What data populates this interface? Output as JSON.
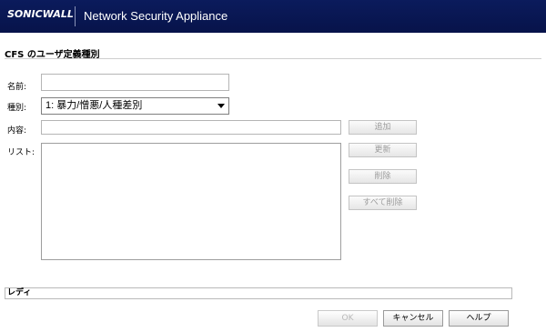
{
  "header": {
    "logo_text": "SONICWALL",
    "app_title": "Network Security Appliance",
    "background_color": "#0b1b5c"
  },
  "page_title": "CFS のユーザ定義種別",
  "form": {
    "name_label": "名前:",
    "name_value": "",
    "category_label": "種別:",
    "category_selected": "1: 暴力/憎悪/人種差別",
    "content_label": "内容:",
    "content_value": "",
    "list_label": "リスト:",
    "list_items": []
  },
  "side_buttons": {
    "add_label": "追加",
    "update_label": "更新",
    "delete_label": "削除",
    "delete_all_label": "すべて削除"
  },
  "status": {
    "text": "レディ"
  },
  "footer_buttons": {
    "ok_label": "OK",
    "cancel_label": "キャンセル",
    "help_label": "ヘルプ"
  }
}
